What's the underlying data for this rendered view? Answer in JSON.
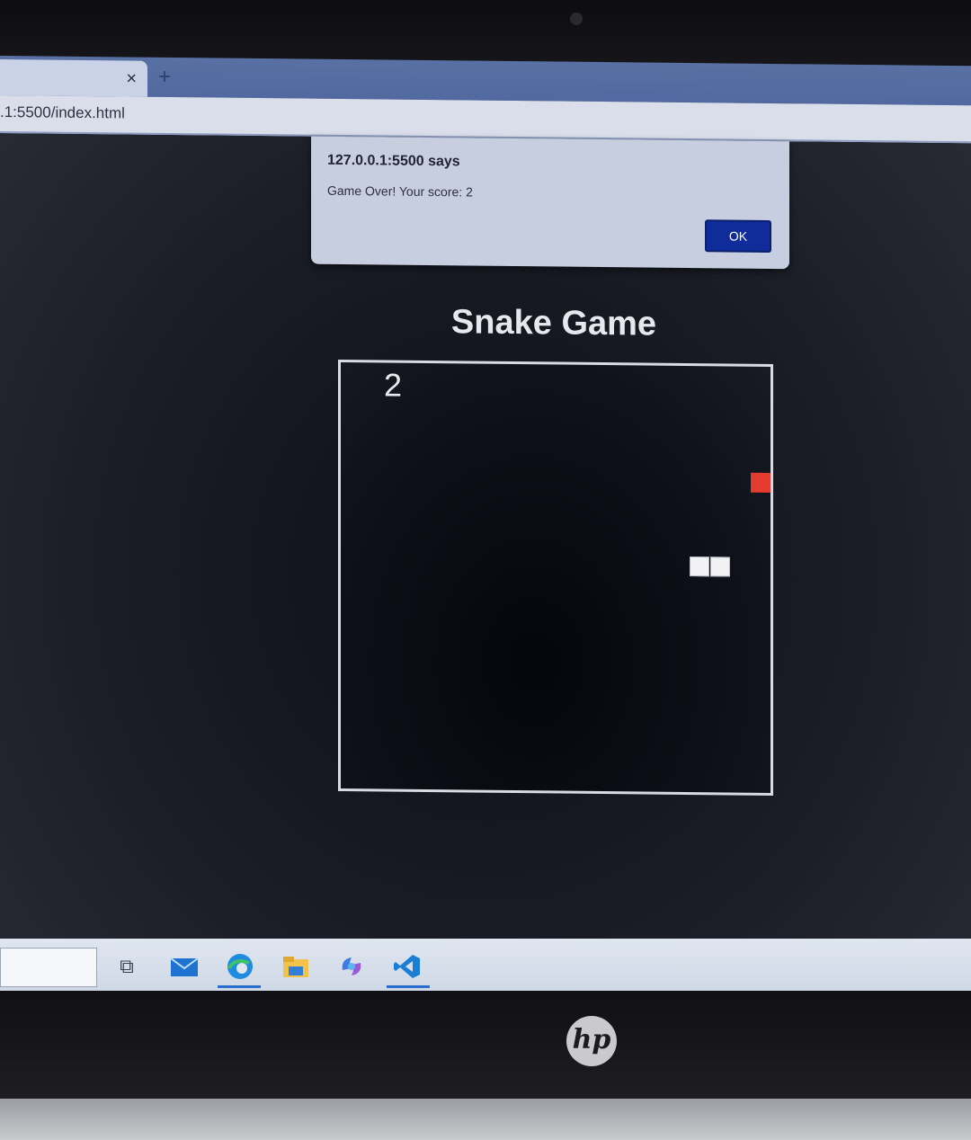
{
  "browser": {
    "tab_close": "×",
    "new_tab": "+",
    "url": ".1:5500/index.html"
  },
  "dialog": {
    "title": "127.0.0.1:5500 says",
    "message": "Game Over! Your score: 2",
    "ok_label": "OK"
  },
  "game": {
    "title": "Snake Game",
    "score": "2",
    "food_color": "#e53a2e",
    "snake_color": "#f2f2f4"
  },
  "taskbar": {
    "icons": [
      "task-view-icon",
      "mail-icon",
      "edge-icon",
      "file-explorer-icon",
      "copilot-icon",
      "vscode-icon"
    ]
  },
  "hardware": {
    "logo": "hp"
  }
}
